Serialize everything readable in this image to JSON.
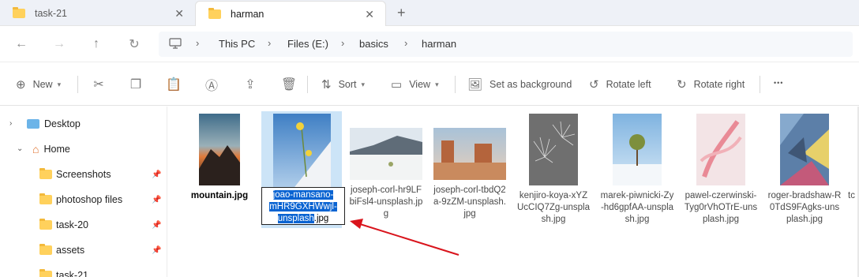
{
  "tabs": [
    {
      "label": "task-21",
      "active": false
    },
    {
      "label": "harman",
      "active": true
    }
  ],
  "new_tab_label": "+",
  "nav": {
    "back_icon": "←",
    "forward_icon": "→",
    "up_icon": "↑",
    "refresh_icon": "↻"
  },
  "breadcrumb": [
    "This PC",
    "Files (E:)",
    "basics",
    "harman"
  ],
  "breadcrumb_sep": "›",
  "commands": {
    "new_label": "New",
    "sort_label": "Sort",
    "view_label": "View",
    "set_background_label": "Set as background",
    "rotate_left_label": "Rotate left",
    "rotate_right_label": "Rotate right",
    "more_label": "•••"
  },
  "sidebar": {
    "items": [
      {
        "label": "Desktop",
        "pinned": false
      },
      {
        "label": "Home",
        "pinned": false
      },
      {
        "label": "Screenshots",
        "pinned": true
      },
      {
        "label": "photoshop files",
        "pinned": true
      },
      {
        "label": "task-20",
        "pinned": true
      },
      {
        "label": "assets",
        "pinned": true
      },
      {
        "label": "task-21",
        "pinned": false
      }
    ]
  },
  "files": [
    {
      "name": "mountain.jpg"
    },
    {
      "name": "joao-mansano-mHR9GXHWwjI-unsplash.jpg",
      "rename_highlight": "joao-mansano-mHR9GXHWwjl-unsplash",
      "rename_ext": ".jpg"
    },
    {
      "name": "joseph-corl-hr9LFbiFsl4-unsplash.jpg"
    },
    {
      "name": "joseph-corl-tbdQ2a-9zZM-unsplash.jpg"
    },
    {
      "name": "kenjiro-koya-xYZUcCIQ7Zg-unsplash.jpg"
    },
    {
      "name": "marek-piwnicki-Zy-hd6gpfAA-unsplash.jpg"
    },
    {
      "name": "pawel-czerwinski-Tyg0rVhOTrE-unsplash.jpg"
    },
    {
      "name": "roger-bradshaw-R0TdS9FAgks-unsplash.jpg"
    },
    {
      "name": "tc f"
    }
  ],
  "colors": {
    "selection": "#cce4f7",
    "rename_highlight": "#0a64d2",
    "arrow": "#d9141c",
    "folder": "#ffd15c"
  }
}
